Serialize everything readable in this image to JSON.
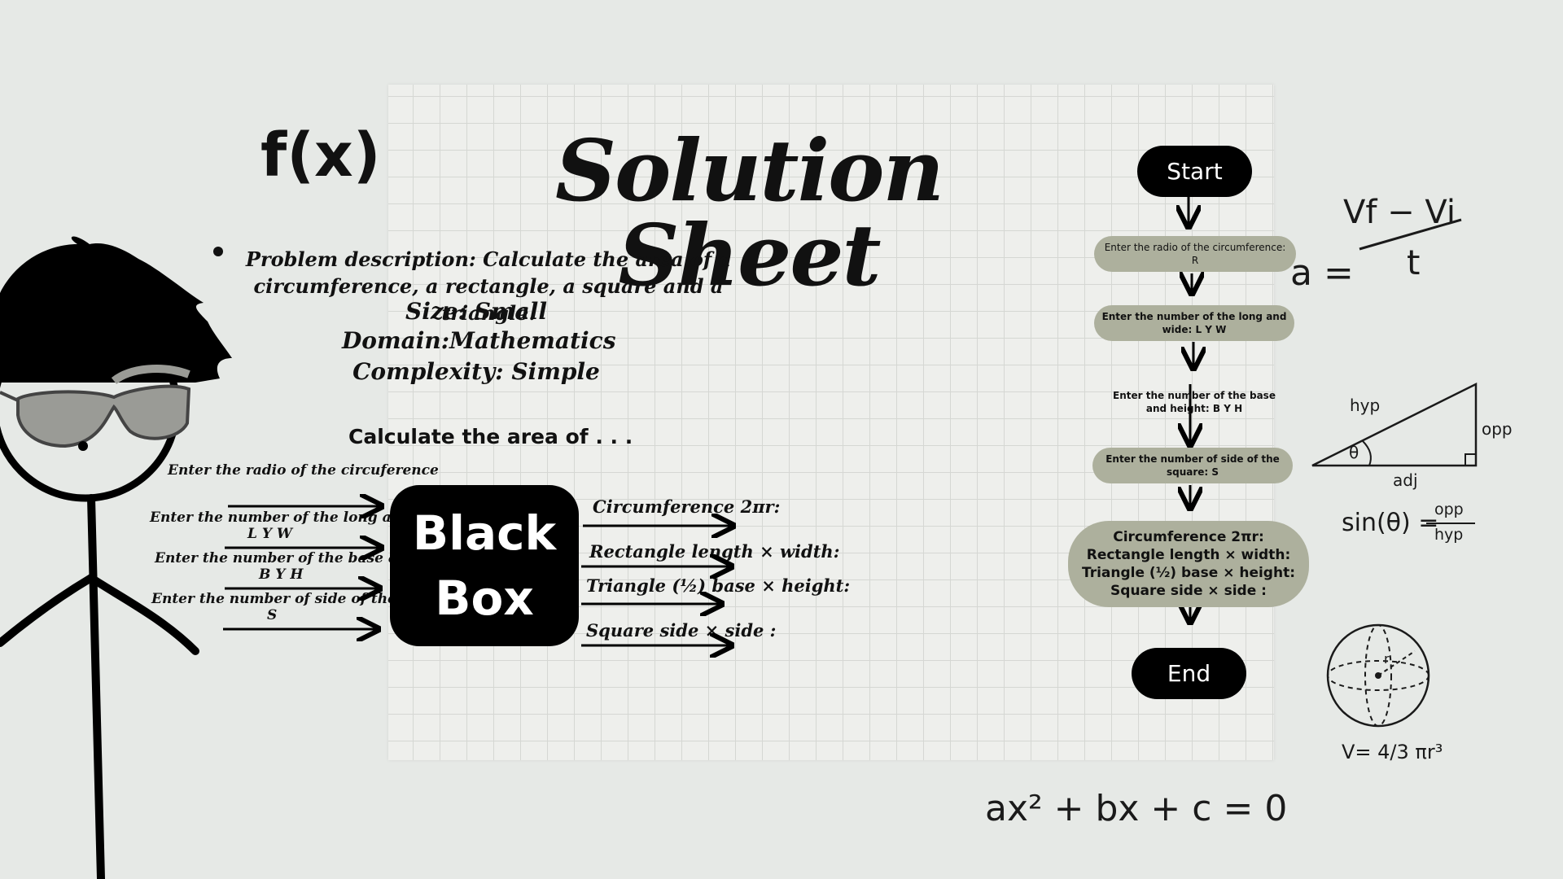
{
  "title": "Solution Sheet",
  "fx_icon": "f(x)",
  "problem": {
    "description_line1": "Problem description: Calculate the area of a",
    "description_line2": "circumference, a rectangle, a square and a triangle.",
    "size": "Size: Small",
    "domain": "Domain:Mathematics",
    "complexity": "Complexity: Simple"
  },
  "calc_heading": "Calculate the area of . . .",
  "inputs": {
    "radio": "Enter the radio of the circuference",
    "long_wide_1": "Enter the number of the long and wide:",
    "long_wide_2": "L Y W",
    "base_height_1": "Enter the number of the base and heigh",
    "base_height_2": "B Y H",
    "side_1": "Enter the number of side of the square:",
    "side_2": "S"
  },
  "black_box": {
    "line1": "Black",
    "line2": "Box"
  },
  "outputs": {
    "circumference": "Circumference 2πr:",
    "rectangle": "Rectangle length × width:",
    "triangle": "Triangle (½) base × height:",
    "square": "Square side × side :"
  },
  "flowchart": {
    "start": "Start",
    "step_radio": "Enter the radio of the circumference: R",
    "step_long_wide": "Enter the number of the long and wide: L Y W",
    "step_base_height": "Enter the number of the base and height: B Y H",
    "step_side": "Enter the number of side of the square: S",
    "result_1": "Circumference 2πr:",
    "result_2": "Rectangle length × width:",
    "result_3": "Triangle (½) base × height:",
    "result_4": "Square side × side :",
    "end": "End"
  },
  "doodles": {
    "accel_lhs": "a =",
    "accel_num": "Vf − Vi",
    "accel_den": "t",
    "hyp": "hyp",
    "opp": "opp",
    "adj": "adj",
    "theta": "θ",
    "sin_lhs": "sin(θ) =",
    "sin_num": "opp",
    "sin_den": "hyp",
    "sphere_r": "r",
    "sphere_formula": "V= 4/3 πr³",
    "quadratic": "ax² + bx + c = 0"
  },
  "colors": {
    "background": "#e6e9e6",
    "sheet": "#eeefec",
    "flow_box": "#adb09d",
    "black": "#000000"
  }
}
